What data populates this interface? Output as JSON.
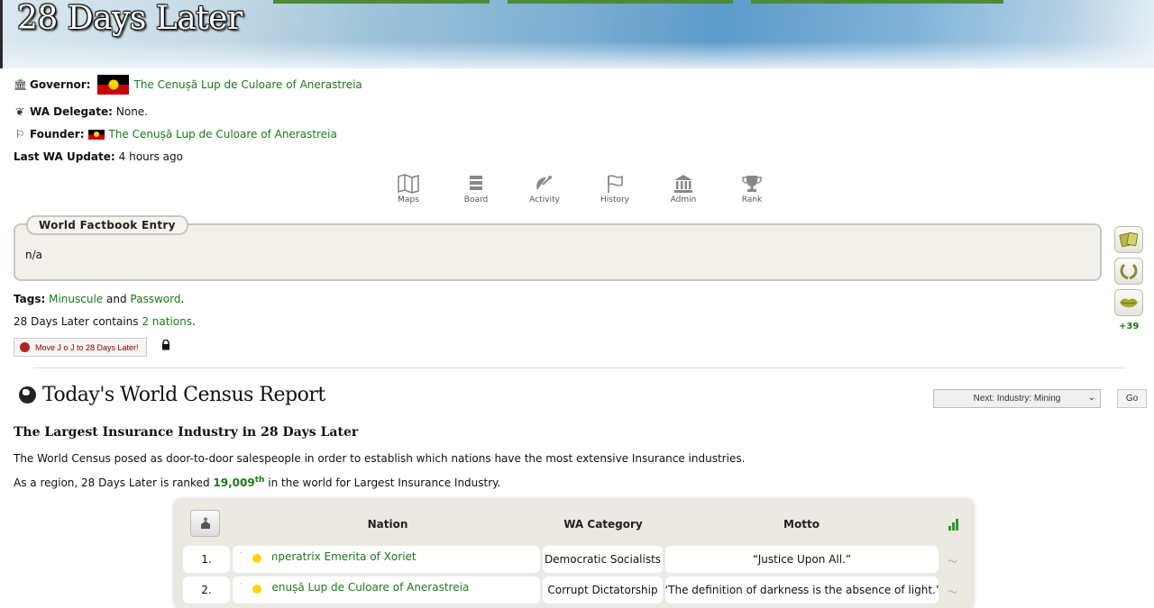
{
  "banner": {
    "title": "28 Days Later"
  },
  "info": {
    "governor_label": "Governor:",
    "governor_name": "The Cenușă Lup de Culoare of Anerastreia",
    "delegate_label": "WA Delegate:",
    "delegate_value": "None.",
    "founder_label": "Founder:",
    "founder_name": "The Cenușă Lup de Culoare of Anerastreia",
    "update_label": "Last WA Update:",
    "update_value": "4 hours ago"
  },
  "nav": [
    {
      "label": "Maps",
      "icon": "map-icon"
    },
    {
      "label": "Board",
      "icon": "board-icon"
    },
    {
      "label": "Activity",
      "icon": "satellite-icon"
    },
    {
      "label": "History",
      "icon": "flag-icon"
    },
    {
      "label": "Admin",
      "icon": "building-icon"
    },
    {
      "label": "Rank",
      "icon": "trophy-icon"
    }
  ],
  "factbook": {
    "label": "World Factbook Entry",
    "text": "n/a"
  },
  "tags": {
    "label": "Tags:",
    "tag1": "Minuscule",
    "and": "and",
    "tag2": "Password",
    "period": "."
  },
  "nations_line": {
    "prefix": "28 Days Later contains",
    "link": "2 nations",
    "suffix": "."
  },
  "move_button": "Move J o J to 28 Days Later!",
  "side": {
    "count": "+39"
  },
  "census": {
    "title": "Today's World Census Report",
    "select_value": "Next: Industry: Mining",
    "go": "Go",
    "heading": "The Largest Insurance Industry in 28 Days Later",
    "description": "The World Census posed as door-to-door salespeople in order to establish which nations have the most extensive Insurance industries.",
    "rank_prefix": "As a region, 28 Days Later is ranked",
    "rank_value": "19,009",
    "rank_suffix_sup": "th",
    "rank_suffix": "in the world for Largest Insurance Industry."
  },
  "table": {
    "headers": {
      "nation": "Nation",
      "category": "WA Category",
      "motto": "Motto"
    },
    "rows": [
      {
        "rank": "1.",
        "nation": "The Imperatrix Emerita of Xoriet",
        "category": "Democratic Socialists",
        "motto": "“Justice Upon All.”"
      },
      {
        "rank": "2.",
        "nation": "The Cenușă Lup de Culoare of Anerastreia",
        "category": "Corrupt Dictatorship",
        "motto": "“The definition of darkness is the absence of light.”"
      }
    ]
  },
  "colors": {
    "link": "#1a7a1a",
    "factbook_bg": "#f1f0eb",
    "table_bg": "#ebe9e1"
  }
}
